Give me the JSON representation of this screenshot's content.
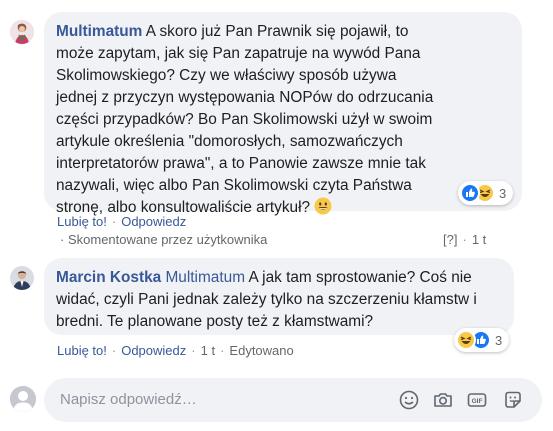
{
  "comment1": {
    "author": "Multimatum",
    "text": "A skoro już Pan Prawnik się pojawił, to\nmoże zapytam, jak się Pan zapatruje na wywód Pana\nSkolimowskiego? Czy we właściwy sposób używa\njednej z przyczyn występowania NOPów do odrzucania\nczęści przypadków? Bo Pan Skolimowski użył w swoim\nartykule określenia \"domorosłych, samozwańczych\ninterpretatorów prawa\", a to Panowie zawsze mnie tak\nnazywali, więc albo Pan Skolimowski czyta Państwa\nstronę, albo konsultowaliście artykuł? ",
    "reaction_count": "3",
    "like_label": "Lubię to!",
    "reply_label": "Odpowiedz",
    "note_label": "Skomentowane przez użytkownika",
    "bracket_label": "[?]",
    "time_label": "1 t"
  },
  "comment2": {
    "author": "Marcin Kostka",
    "mention": "Multimatum",
    "text": "A jak tam sprostowanie? Coś nie\nwidać, czyli Pani jednak zależy tylko na szczerzeniu kłamstw i\nbredni. Te planowane posty też z kłamstwami?",
    "reaction_count": "3",
    "like_label": "Lubię to!",
    "reply_label": "Odpowiedz",
    "time_label": "1 t",
    "edited_label": "Edytowano"
  },
  "reply_box": {
    "placeholder": "Napisz odpowiedź…"
  }
}
